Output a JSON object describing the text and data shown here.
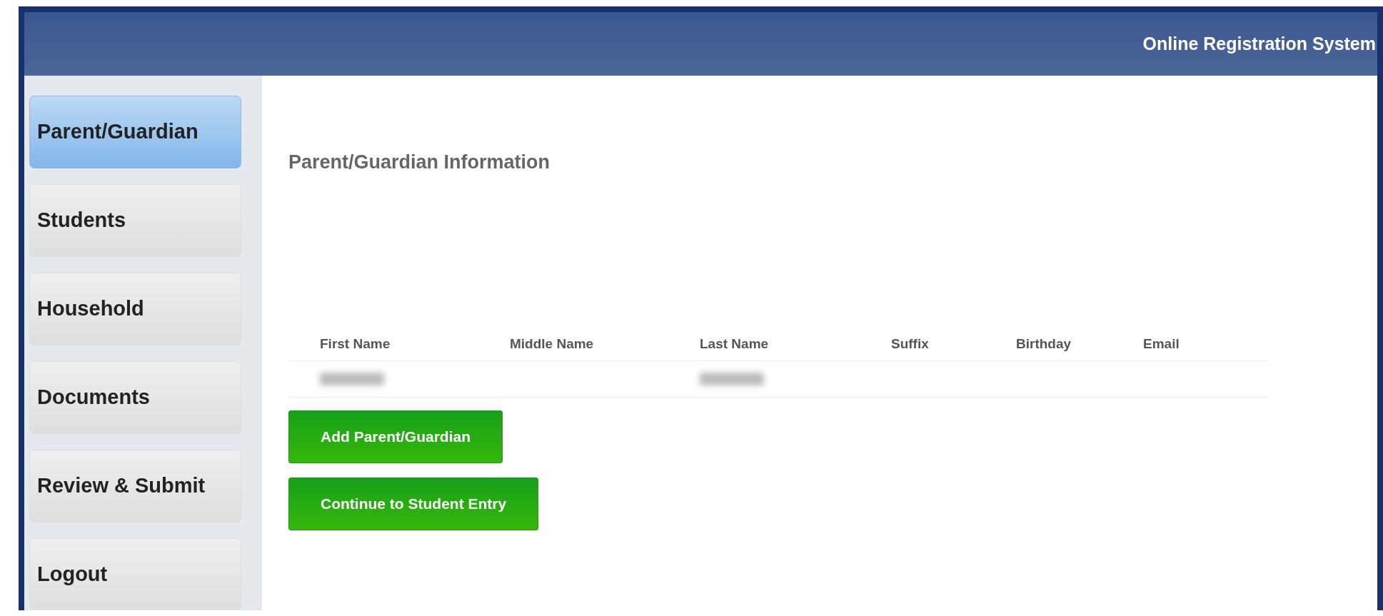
{
  "header": {
    "title": "Online Registration System"
  },
  "sidebar": {
    "items": [
      {
        "label": "Parent/Guardian",
        "selected": true
      },
      {
        "label": "Students",
        "selected": false
      },
      {
        "label": "Household",
        "selected": false
      },
      {
        "label": "Documents",
        "selected": false
      },
      {
        "label": "Review & Submit",
        "selected": false
      },
      {
        "label": "Logout",
        "selected": false
      }
    ]
  },
  "main": {
    "heading": "Parent/Guardian Information",
    "table": {
      "columns": [
        "First Name",
        "Middle Name",
        "Last Name",
        "Suffix",
        "Birthday",
        "Email"
      ],
      "rows": [
        {
          "cells": [
            {
              "kind": "redacted"
            },
            {
              "kind": "blank"
            },
            {
              "kind": "redacted"
            },
            {
              "kind": "blank"
            },
            {
              "kind": "blank"
            },
            {
              "kind": "blank"
            }
          ]
        }
      ]
    },
    "buttons": [
      "Add Parent/Guardian",
      "Continue to Student Entry"
    ]
  }
}
